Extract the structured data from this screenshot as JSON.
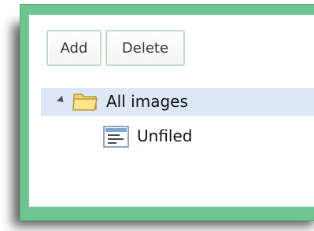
{
  "toolbar": {
    "add_label": "Add",
    "delete_label": "Delete"
  },
  "tree": {
    "root": {
      "label": "All images",
      "icon": "folder-icon",
      "expanded": true,
      "selected": true
    },
    "children": [
      {
        "label": "Unfiled",
        "icon": "document-icon"
      }
    ]
  },
  "colors": {
    "frame": "#6ec591",
    "selection": "#dde8f6",
    "button_border": "#bcdcc8"
  }
}
